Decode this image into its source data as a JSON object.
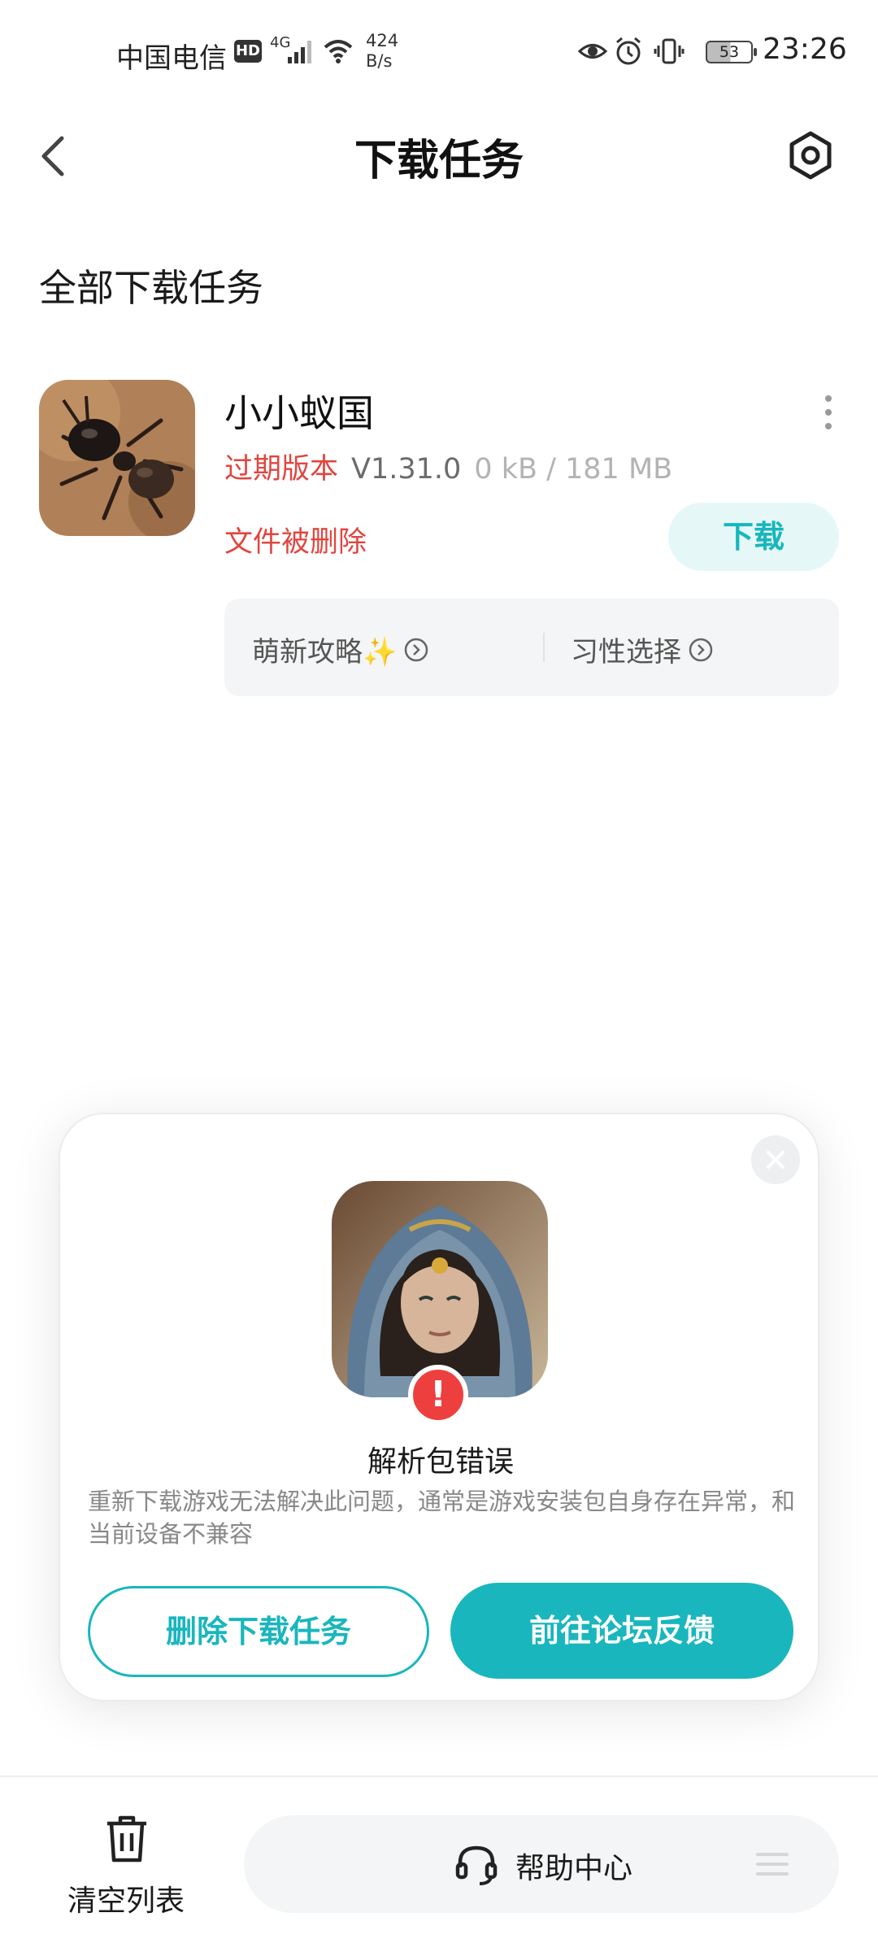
{
  "status_bar": {
    "carrier": "中国电信",
    "hd": "HD",
    "network": "4G",
    "speed_value": "424",
    "speed_unit": "B/s",
    "battery": "53",
    "time": "23:26"
  },
  "header": {
    "title": "下载任务"
  },
  "section": {
    "title": "全部下载任务"
  },
  "download_item": {
    "name": "小小蚁国",
    "expired_label": "过期版本",
    "version": "V1.31.0",
    "size": "0 kB / 181 MB",
    "status": "文件被删除",
    "download_label": "下载",
    "tips": [
      {
        "label": "萌新攻略✨"
      },
      {
        "label": "习性选择"
      }
    ]
  },
  "dialog": {
    "badge": "!",
    "title": "解析包错误",
    "description": "重新下载游戏无法解决此问题，通常是游戏安装包自身存在异常，和当前设备不兼容",
    "delete_label": "删除下载任务",
    "forum_label": "前往论坛反馈"
  },
  "bottom_bar": {
    "clear_label": "清空列表",
    "help_label": "帮助中心"
  },
  "colors": {
    "accent": "#19b6bd",
    "warning": "#e0463f",
    "error_badge": "#ee3f3f"
  }
}
